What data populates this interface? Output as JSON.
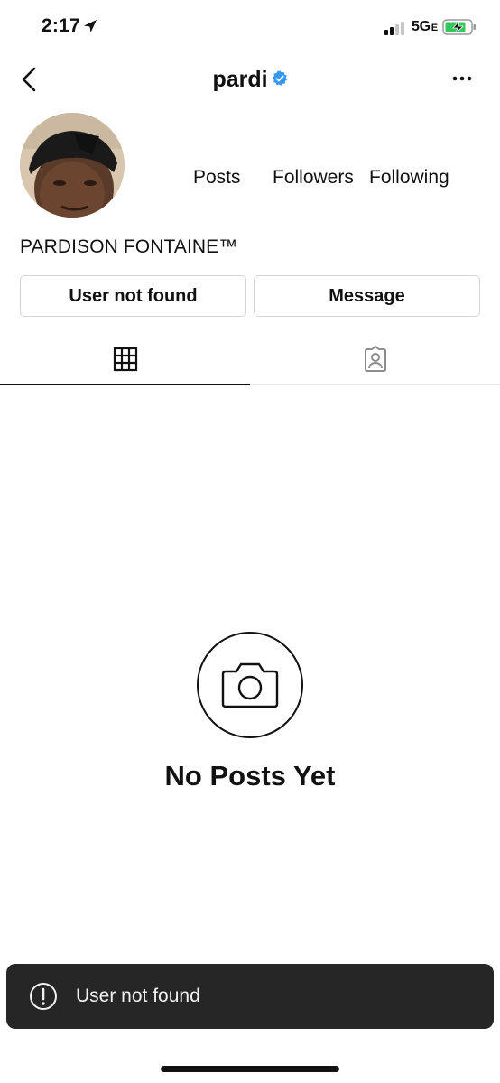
{
  "status_bar": {
    "time": "2:17",
    "network": "5G",
    "network_suffix": "E"
  },
  "header": {
    "username": "pardi"
  },
  "profile": {
    "display_name": "PARDISON FONTAINE™",
    "stats": {
      "posts_label": "Posts",
      "followers_label": "Followers",
      "following_label": "Following"
    },
    "buttons": {
      "follow_label": "User not found",
      "message_label": "Message"
    }
  },
  "tabs": [
    {
      "name": "grid",
      "icon": "grid-icon",
      "active": true
    },
    {
      "name": "tagged",
      "icon": "tagged-person-icon",
      "active": false
    }
  ],
  "empty_state": {
    "icon": "camera-icon",
    "title": "No Posts Yet"
  },
  "toast": {
    "icon": "exclamation-circle-icon",
    "message": "User not found"
  },
  "colors": {
    "verified_badge": "#3897f0",
    "battery_fill": "#34c759",
    "toast_bg": "#262626"
  }
}
